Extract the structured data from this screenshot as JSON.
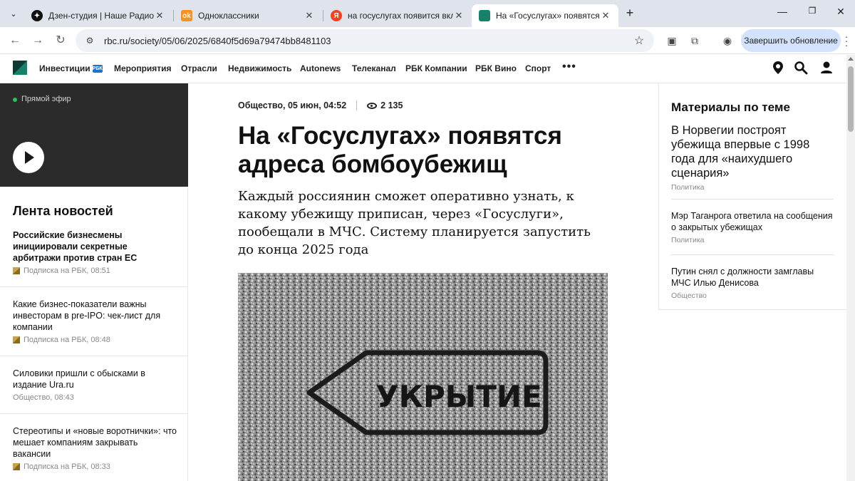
{
  "browser": {
    "tabs": [
      {
        "title": "Дзен-студия | Наше Радио усл",
        "icon": "zen-icon"
      },
      {
        "title": "Одноклассники",
        "icon": "ok-icon"
      },
      {
        "title": "на госуслугах появится вклад",
        "icon": "yandex-icon"
      },
      {
        "title": "На «Госуслугах» появятся адре",
        "icon": "rbc-icon",
        "active": true
      }
    ],
    "url": "rbc.ru/society/05/06/2025/6840f5d69a79474bb8481103",
    "update_button": "Завершить обновление"
  },
  "site_nav": {
    "items": [
      "Инвестиции",
      "Мероприятия",
      "Отрасли",
      "Недвижимость",
      "Autonews",
      "Телеканал",
      "РБК Компании",
      "РБК Вино",
      "Спорт"
    ],
    "more": "•••"
  },
  "live": {
    "label": "Прямой эфир"
  },
  "feed": {
    "title": "Лента новостей",
    "items": [
      {
        "title": "Российские бизнесмены инициировали секретные арбитражи против стран ЕС",
        "meta": "Подписка на РБК, 08:51",
        "bold": true,
        "subscription": true
      },
      {
        "title": "Какие бизнес-показатели важны инвесторам в pre-IPO: чек-лист для компании",
        "meta": "Подписка на РБК, 08:48",
        "bold": false,
        "subscription": true
      },
      {
        "title": "Силовики пришли с обысками в издание Ura.ru",
        "meta": "Общество, 08:43",
        "bold": false,
        "subscription": false
      },
      {
        "title": "Стереотипы и «новые воротнички»: что мешает компаниям закрывать вакансии",
        "meta": "Подписка на РБК, 08:33",
        "bold": false,
        "subscription": true
      }
    ]
  },
  "article": {
    "meta": "Общество, 05 июн, 04:52",
    "views": "2 135",
    "headline": "На «Госуслугах» появятся адреса бомбоубежищ",
    "lead": "Каждый россиянин сможет оперативно узнать, к какому убежищу приписан, через «Госуслуги», пообещали в МЧС. Систему планируется запустить до конца 2025 года",
    "photo_text": "УКРЫТИЕ"
  },
  "related": {
    "title": "Материалы по теме",
    "items": [
      {
        "title": "В Норвегии построят убежища впервые с 1998 года для «наихудшего сценария»",
        "category": "Политика",
        "large": true
      },
      {
        "title": "Мэр Таганрога ответила на сообщения о закрытых убежищах",
        "category": "Политика",
        "large": false
      },
      {
        "title": "Путин снял с должности замглавы МЧС Илью Денисова",
        "category": "Общество",
        "large": false
      }
    ]
  },
  "colors": {
    "brand_green": "#17826b",
    "live_dot": "#22c55e",
    "update_btn": "#d3e3fd"
  }
}
